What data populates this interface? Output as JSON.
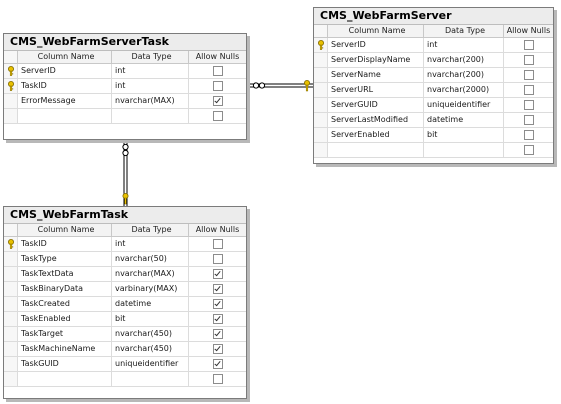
{
  "tables": {
    "server_task": {
      "title": "CMS_WebFarmServerTask",
      "headers": {
        "name": "Column Name",
        "type": "Data Type",
        "nulls": "Allow Nulls"
      },
      "rows": [
        {
          "name": "ServerID",
          "type": "int",
          "key": true,
          "null": false
        },
        {
          "name": "TaskID",
          "type": "int",
          "key": true,
          "null": false
        },
        {
          "name": "ErrorMessage",
          "type": "nvarchar(MAX)",
          "key": false,
          "null": true
        },
        {
          "name": "",
          "type": "",
          "key": false,
          "null": false
        }
      ]
    },
    "server": {
      "title": "CMS_WebFarmServer",
      "headers": {
        "name": "Column Name",
        "type": "Data Type",
        "nulls": "Allow Nulls"
      },
      "rows": [
        {
          "name": "ServerID",
          "type": "int",
          "key": true,
          "null": false
        },
        {
          "name": "ServerDisplayName",
          "type": "nvarchar(200)",
          "key": false,
          "null": false
        },
        {
          "name": "ServerName",
          "type": "nvarchar(200)",
          "key": false,
          "null": false
        },
        {
          "name": "ServerURL",
          "type": "nvarchar(2000)",
          "key": false,
          "null": false
        },
        {
          "name": "ServerGUID",
          "type": "uniqueidentifier",
          "key": false,
          "null": false
        },
        {
          "name": "ServerLastModified",
          "type": "datetime",
          "key": false,
          "null": false
        },
        {
          "name": "ServerEnabled",
          "type": "bit",
          "key": false,
          "null": false
        },
        {
          "name": "",
          "type": "",
          "key": false,
          "null": false
        }
      ]
    },
    "task": {
      "title": "CMS_WebFarmTask",
      "headers": {
        "name": "Column Name",
        "type": "Data Type",
        "nulls": "Allow Nulls"
      },
      "rows": [
        {
          "name": "TaskID",
          "type": "int",
          "key": true,
          "null": false
        },
        {
          "name": "TaskType",
          "type": "nvarchar(50)",
          "key": false,
          "null": false
        },
        {
          "name": "TaskTextData",
          "type": "nvarchar(MAX)",
          "key": false,
          "null": true
        },
        {
          "name": "TaskBinaryData",
          "type": "varbinary(MAX)",
          "key": false,
          "null": true
        },
        {
          "name": "TaskCreated",
          "type": "datetime",
          "key": false,
          "null": true
        },
        {
          "name": "TaskEnabled",
          "type": "bit",
          "key": false,
          "null": true
        },
        {
          "name": "TaskTarget",
          "type": "nvarchar(450)",
          "key": false,
          "null": true
        },
        {
          "name": "TaskMachineName",
          "type": "nvarchar(450)",
          "key": false,
          "null": true
        },
        {
          "name": "TaskGUID",
          "type": "uniqueidentifier",
          "key": false,
          "null": true
        },
        {
          "name": "",
          "type": "",
          "key": false,
          "null": false
        }
      ]
    }
  },
  "colors": {
    "key_fill": "#e8c000",
    "key_stroke": "#806a00",
    "line": "#000000"
  }
}
